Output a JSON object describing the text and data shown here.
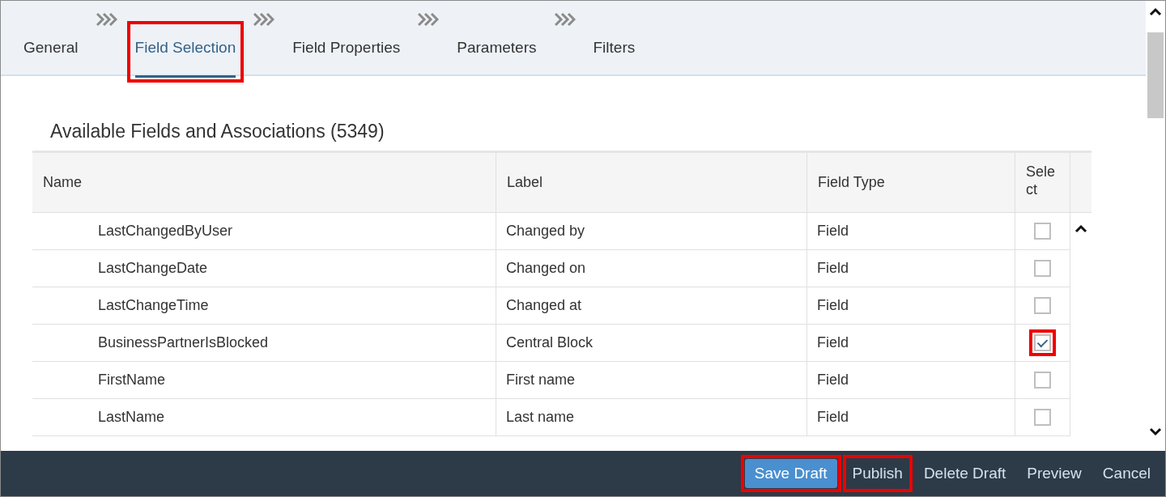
{
  "wizard_steps": [
    {
      "label": "General",
      "selected": false,
      "highlighted": false
    },
    {
      "label": "Field Selection",
      "selected": true,
      "highlighted": true
    },
    {
      "label": "Field Properties",
      "selected": false,
      "highlighted": false
    },
    {
      "label": "Parameters",
      "selected": false,
      "highlighted": false
    },
    {
      "label": "Filters",
      "selected": false,
      "highlighted": false
    }
  ],
  "section_title": "Available Fields and Associations (5349)",
  "table": {
    "columns": [
      "Name",
      "Label",
      "Field Type",
      "Sele\nct"
    ],
    "rows": [
      {
        "name": "LastChangedByUser",
        "label": "Changed by",
        "field_type": "Field",
        "checked": false,
        "highlighted": false
      },
      {
        "name": "LastChangeDate",
        "label": "Changed on",
        "field_type": "Field",
        "checked": false,
        "highlighted": false
      },
      {
        "name": "LastChangeTime",
        "label": "Changed at",
        "field_type": "Field",
        "checked": false,
        "highlighted": false
      },
      {
        "name": "BusinessPartnerIsBlocked",
        "label": "Central Block",
        "field_type": "Field",
        "checked": true,
        "highlighted": true
      },
      {
        "name": "FirstName",
        "label": "First name",
        "field_type": "Field",
        "checked": false,
        "highlighted": false
      },
      {
        "name": "LastName",
        "label": "Last name",
        "field_type": "Field",
        "checked": false,
        "highlighted": false
      }
    ]
  },
  "footer_buttons": [
    {
      "label": "Save Draft",
      "kind": "primary",
      "highlighted": true
    },
    {
      "label": "Publish",
      "kind": "text",
      "highlighted": true
    },
    {
      "label": "Delete Draft",
      "kind": "text",
      "highlighted": false
    },
    {
      "label": "Preview",
      "kind": "text",
      "highlighted": false
    },
    {
      "label": "Cancel",
      "kind": "text",
      "highlighted": false
    }
  ]
}
